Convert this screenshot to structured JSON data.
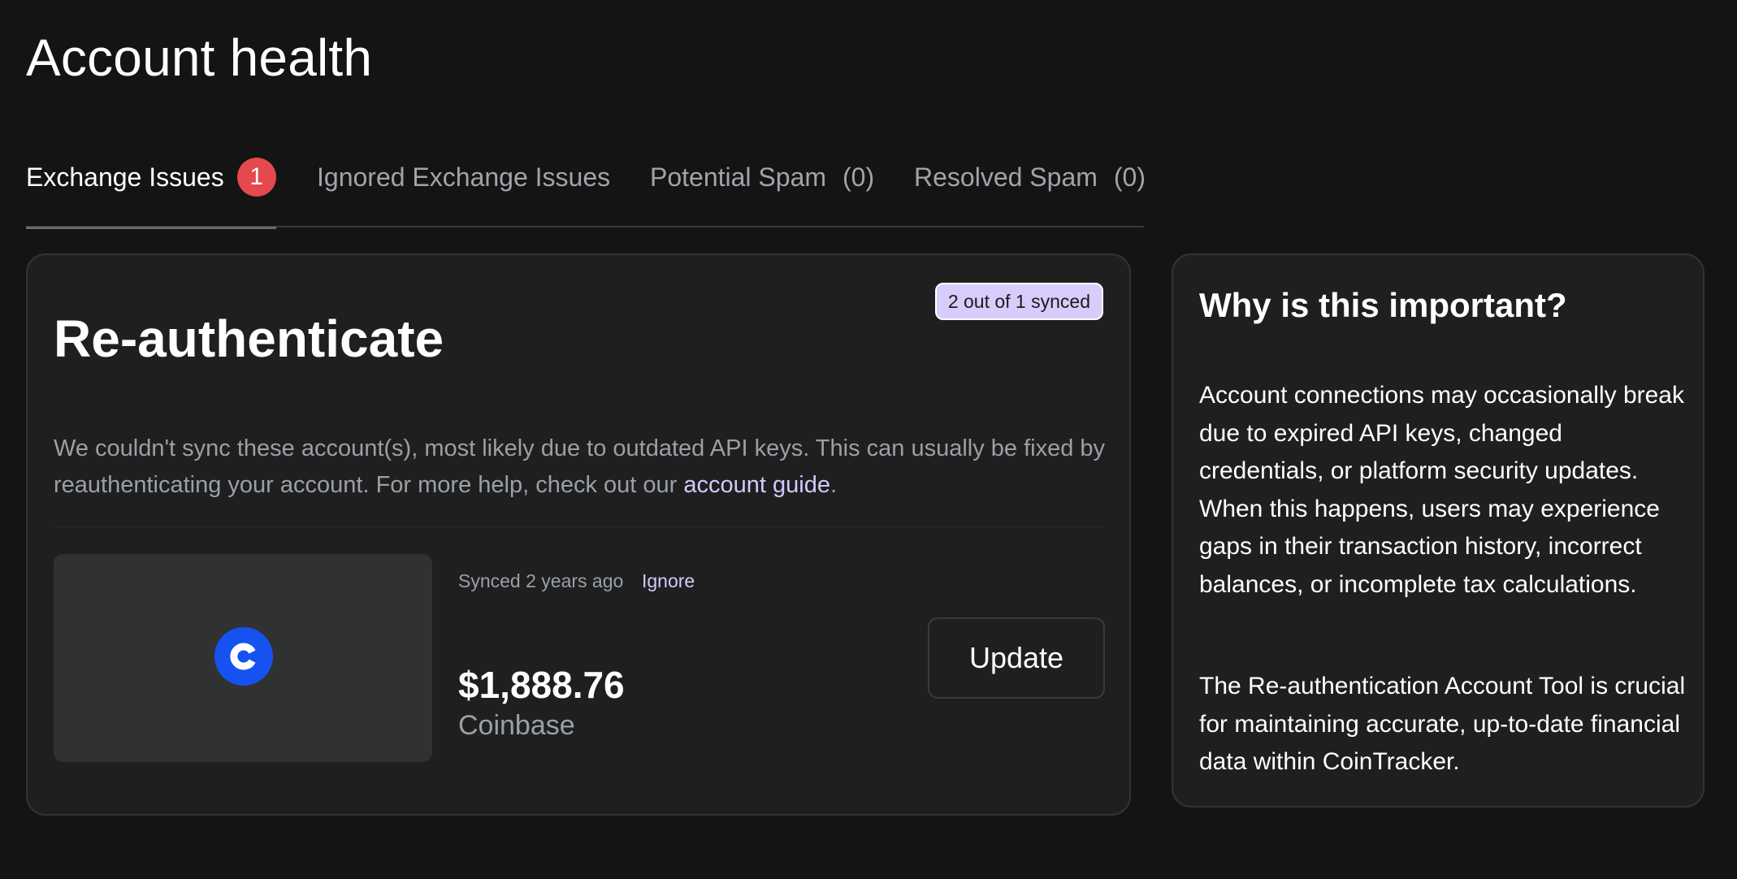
{
  "page": {
    "title": "Account health"
  },
  "tabs": [
    {
      "label": "Exchange Issues",
      "badge": "1"
    },
    {
      "label": "Ignored Exchange Issues"
    },
    {
      "label": "Potential Spam",
      "count": "(0)"
    },
    {
      "label": "Resolved Spam",
      "count": "(0)"
    }
  ],
  "issue_card": {
    "sync_badge": "2 out of 1 synced",
    "title": "Re-authenticate",
    "description": "We couldn't sync these account(s), most likely due to outdated API keys. This can usually be fixed by reauthenticating your account. For more help, check out our ",
    "link_text": "account guide",
    "description_end": ".",
    "account": {
      "synced_text": "Synced 2 years ago",
      "ignore_label": "Ignore",
      "balance": "$1,888.76",
      "exchange": "Coinbase",
      "logo_icon": "coinbase-icon",
      "logo_color": "#1652F0"
    },
    "update_label": "Update"
  },
  "info_card": {
    "title": "Why is this important?",
    "paragraph1": "Account connections may occasionally break due to expired API keys, changed credentials, or platform security updates. When this happens, users may experience gaps in their transaction history, incorrect balances, or incomplete tax calculations.",
    "paragraph2": "The Re-authentication Account Tool is crucial for maintaining accurate, up-to-date financial data within CoinTracker."
  },
  "colors": {
    "background": "#141414",
    "card": "#1f1f1f",
    "accent_link": "#d5c8ff",
    "badge_red": "#e5484d",
    "sync_badge_bg": "#d7ccfb"
  }
}
